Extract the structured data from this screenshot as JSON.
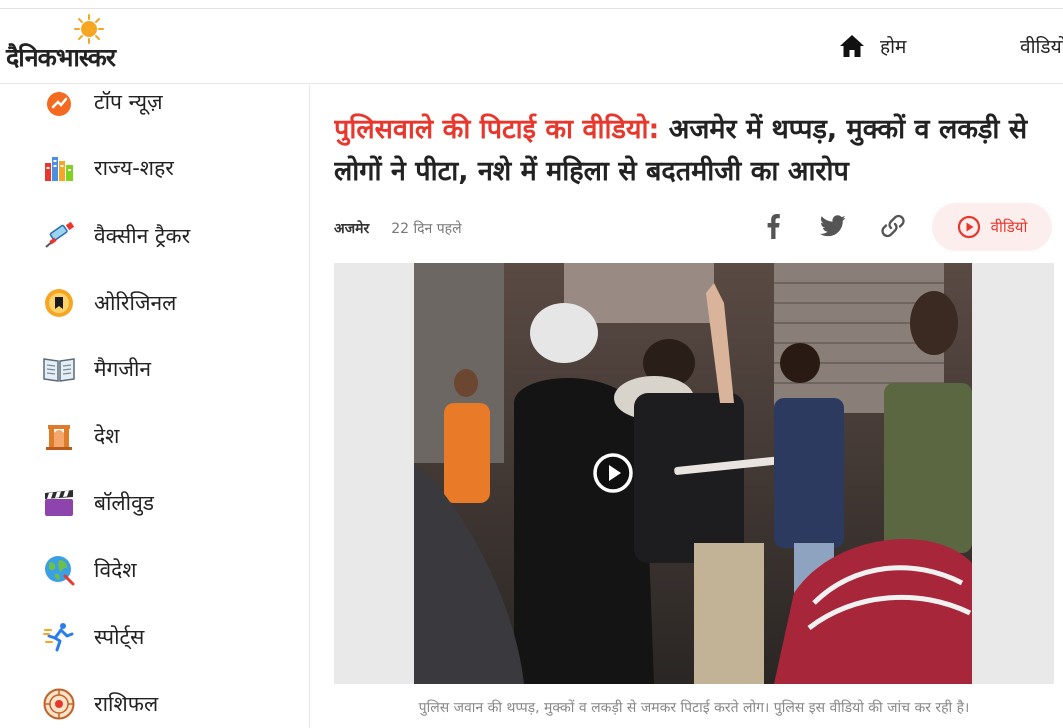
{
  "header": {
    "logo_text": "दैनिकभास्कर",
    "nav": [
      {
        "label": "होम",
        "icon": "home-icon"
      },
      {
        "label": "वीडियो",
        "icon": "play-circle-icon"
      }
    ]
  },
  "sidebar": {
    "items": [
      {
        "label": "टॉप न्यूज़",
        "icon": "fire-icon"
      },
      {
        "label": "राज्य-शहर",
        "icon": "city-buildings-icon"
      },
      {
        "label": "वैक्सीन ट्रैकर",
        "icon": "syringe-icon"
      },
      {
        "label": "ओरिजिनल",
        "icon": "original-badge-icon"
      },
      {
        "label": "मैगजीन",
        "icon": "magazine-icon"
      },
      {
        "label": "देश",
        "icon": "india-gate-icon"
      },
      {
        "label": "बॉलीवुड",
        "icon": "clapperboard-icon"
      },
      {
        "label": "विदेश",
        "icon": "globe-icon"
      },
      {
        "label": "स्पोर्ट्स",
        "icon": "runner-icon"
      },
      {
        "label": "राशिफल",
        "icon": "zodiac-icon"
      }
    ]
  },
  "article": {
    "headline_red": "पुलिसवाले की पिटाई का वीडियो:",
    "headline_rest": " अजमेर में थप्पड़, मुक्कों व लकड़ी से लोगों ने पीटा, नशे में महिला से बदतमीजी का आरोप",
    "city": "अजमेर",
    "time": "22 दिन पहले",
    "share_icons": [
      "facebook-icon",
      "twitter-icon",
      "link-icon"
    ],
    "video_button_label": "वीडियो",
    "caption": "पुलिस जवान की थप्पड़, मुक्कों व लकड़ी से जमकर पिटाई करते लोग। पुलिस इस वीडियो की जांच कर रही है।"
  },
  "colors": {
    "accent_red": "#e8372c",
    "logo_sun": "#f5a623",
    "video_pill_bg": "#fdeeee"
  }
}
